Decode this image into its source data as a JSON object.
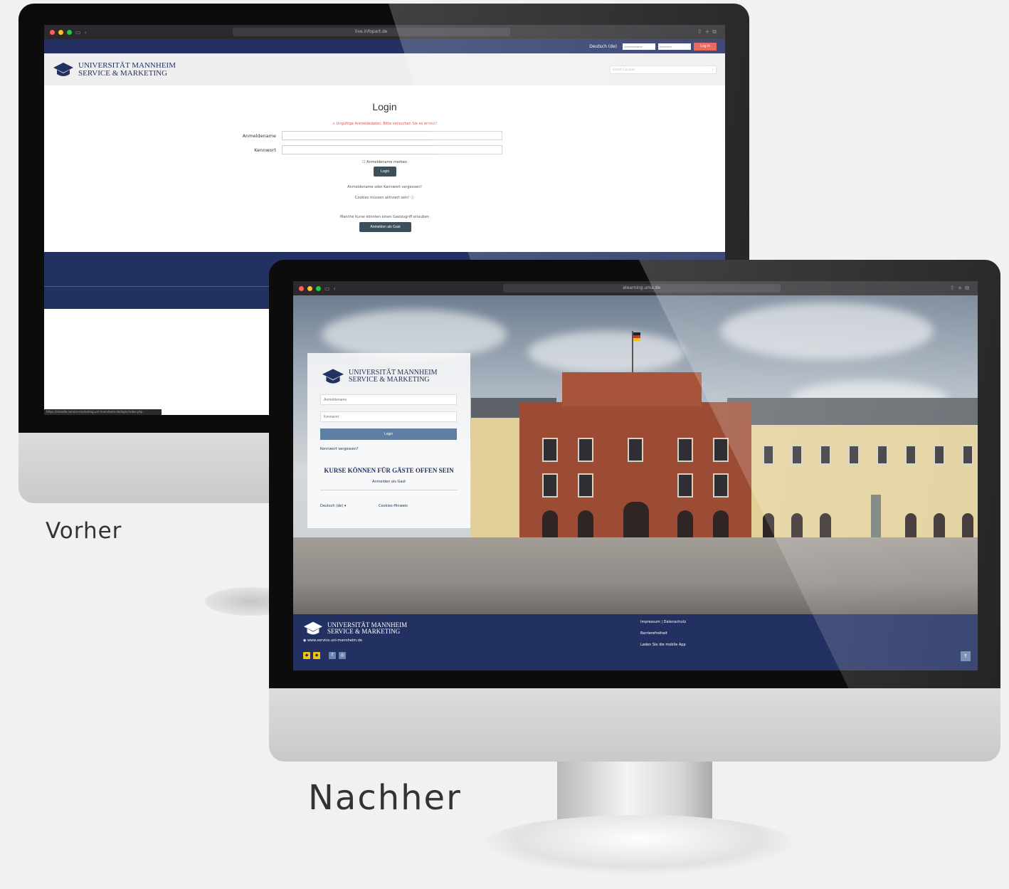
{
  "captions": {
    "before": "Vorher",
    "after": "Nachher"
  },
  "colors": {
    "navy": "#233162",
    "login_red": "#e65548",
    "button_slate": "#3d4f5b",
    "after_button": "#5f7ea3",
    "error_red": "#d9534f"
  },
  "before": {
    "browser": {
      "url": "live.infopart.de"
    },
    "topbar": {
      "language": "Deutsch (de)",
      "username_placeholder": "Anmeldename",
      "password_placeholder": "Kennwort",
      "login_button": "Log in"
    },
    "logo": {
      "line1": "UNIVERSITÄT MANNHEIM",
      "line2": "SERVICE & MARKETING"
    },
    "search": {
      "placeholder": "Search Courses"
    },
    "login": {
      "title": "Login",
      "error": "Ungültige Anmeldedaten. Bitte versuchen Sie es erneut!",
      "username_label": "Anmeldename",
      "password_label": "Kennwort",
      "remember": "Anmeldename merken",
      "submit": "Login",
      "forgot": "Anmeldename oder Kennwort vergessen?",
      "cookies": "Cookies müssen aktiviert sein!",
      "guest_info": "Manche Kurse könnten einen Gastzugriff erlauben",
      "guest_button": "Anmelden als Gast"
    },
    "status_url": "https://moodle.service-marketing.uni-mannheim.de/login/index.php"
  },
  "after": {
    "browser": {
      "url": "elearning.uma.de"
    },
    "logo": {
      "line1": "UNIVERSITÄT MANNHEIM",
      "line2": "SERVICE & MARKETING"
    },
    "login": {
      "username_placeholder": "Anmeldename",
      "password_placeholder": "Kennwort",
      "submit": "Login",
      "forgot": "Kennwort vergessen?",
      "guest_heading": "KURSE KÖNNEN FÜR GÄSTE OFFEN SEIN",
      "guest_link": "Anmelden als Gast",
      "language": "Deutsch (de)",
      "cookies_notice": "Cookies-Hinweis"
    },
    "footer": {
      "website": "www.service.uni-mannheim.de",
      "links": [
        "Impressum",
        "Datenschutz"
      ],
      "extra": "Barrierefreiheit",
      "app": "Laden Sie die mobile App"
    }
  }
}
